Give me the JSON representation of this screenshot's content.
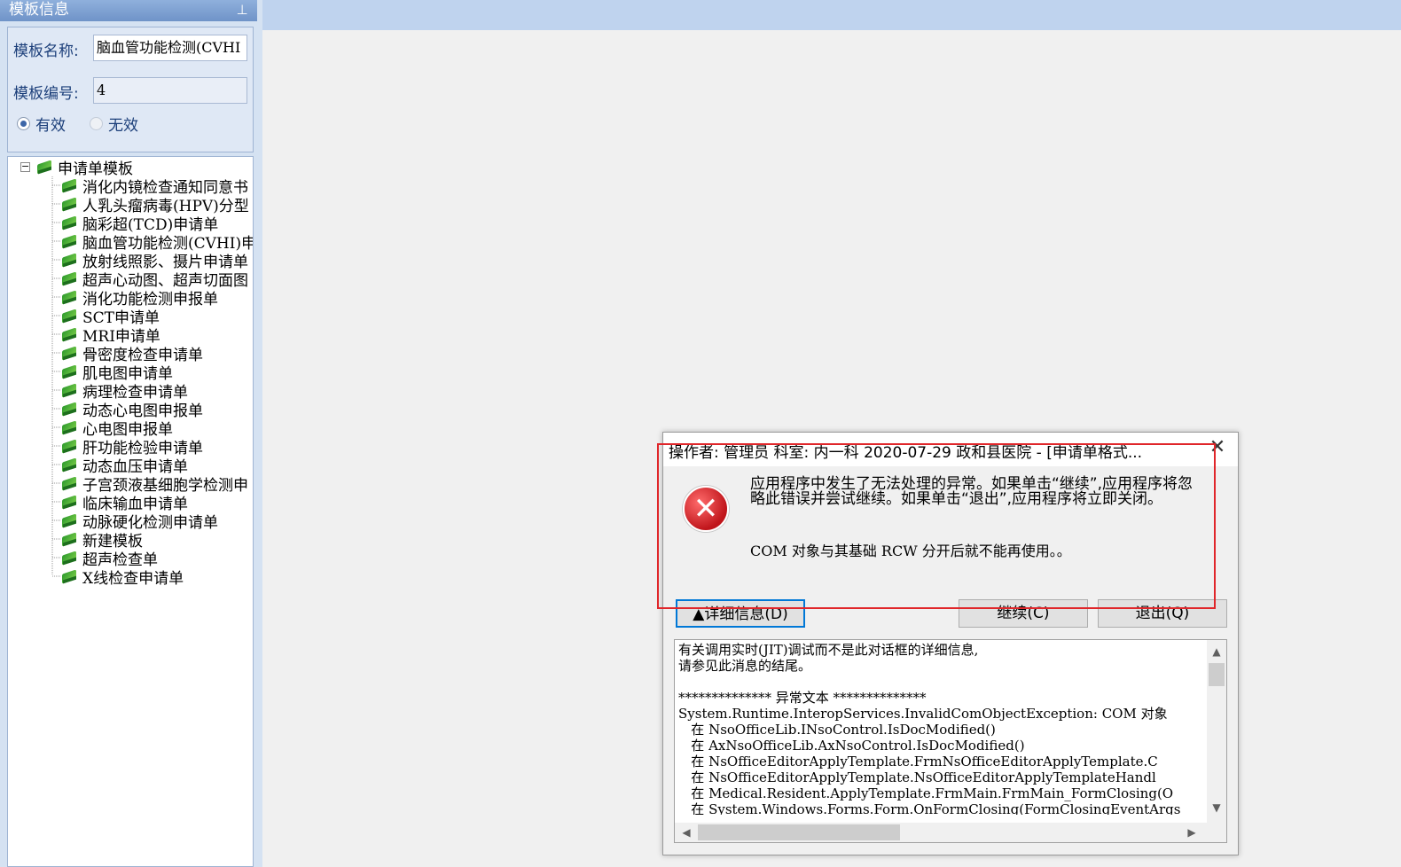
{
  "panel": {
    "title": "模板信息",
    "pin_icon": "pin-icon",
    "name_label": "模板名称:",
    "name_value": "脑血管功能检测(CVHI",
    "number_label": "模板编号:",
    "number_value": "4",
    "radio_valid": "有效",
    "radio_invalid": "无效",
    "selected": "有效"
  },
  "tree": {
    "root": "申请单模板",
    "items": [
      "消化内镜检查通知同意书",
      "人乳头瘤病毒(HPV)分型",
      "脑彩超(TCD)申请单",
      "脑血管功能检测(CVHI)申",
      "放射线照影、摄片申请单",
      "超声心动图、超声切面图",
      "消化功能检测申报单",
      "SCT申请单",
      "MRI申请单",
      "骨密度检查申请单",
      "肌电图申请单",
      "病理检查申请单",
      "动态心电图申报单",
      "心电图申报单",
      "肝功能检验申请单",
      "动态血压申请单",
      "子宫颈液基细胞学检测申",
      "临床输血申请单",
      "动脉硬化检测申请单",
      "新建模板",
      "超声检查单",
      "X线检查申请单"
    ]
  },
  "dialog": {
    "title": "操作者: 管理员 科室: 内一科 2020-07-29 政和县医院 - [申请单格式...",
    "message": "应用程序中发生了无法处理的异常。如果单击“继续”,应用程序将忽略此错误并尝试继续。如果单击“退出”,应用程序将立即关闭。",
    "submessage": "COM 对象与其基础 RCW 分开后就不能再使用。。",
    "details_button": "▲详细信息(D)",
    "continue_button": "继续(C)",
    "quit_button": "退出(Q)",
    "details_text": "有关调用实时(JIT)调试而不是此对话框的详细信息,\n请参见此消息的结尾。\n\n************** 异常文本 **************\nSystem.Runtime.InteropServices.InvalidComObjectException: COM 对象\n   在 NsoOfficeLib.INsoControl.IsDocModified()\n   在 AxNsoOfficeLib.AxNsoControl.IsDocModified()\n   在 NsOfficeEditorApplyTemplate.FrmNsOfficeEditorApplyTemplate.C\n   在 NsOfficeEditorApplyTemplate.NsOfficeEditorApplyTemplateHandl\n   在 Medical.Resident.ApplyTemplate.FrmMain.FrmMain_FormClosing(O\n   在 System.Windows.Forms.Form.OnFormClosing(FormClosingEventArgs"
  },
  "colors": {
    "highlight": "#e0262a",
    "panel_bg": "#d5e2f2",
    "title_bar": "#6f93c8",
    "focus": "#0078d7"
  }
}
